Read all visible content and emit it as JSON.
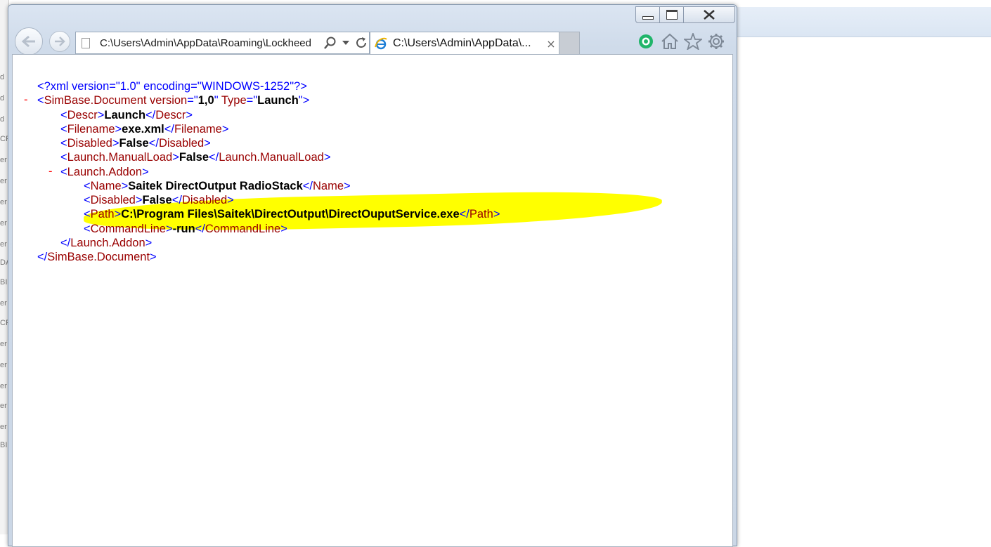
{
  "browser": {
    "address": "C:\\Users\\Admin\\AppData\\Roaming\\Lockheed",
    "tab_title": "C:\\Users\\Admin\\AppData\\...",
    "tab_close": "×"
  },
  "background_strip_letters": [
    "d",
    "d",
    "d",
    "CF",
    "er",
    "er",
    "er",
    "er",
    "er",
    "DA",
    "BI",
    "er",
    "CF",
    "er",
    "er",
    "er",
    "er",
    "er",
    "BI"
  ],
  "xml": {
    "declaration": "<?xml version=\"1.0\" encoding=\"WINDOWS-1252\"?>",
    "collapse_marker": "-",
    "root_open_tag": "SimBase.Document",
    "root_attr1_name": "version",
    "root_attr1_value": "1,0",
    "root_attr2_name": "Type",
    "root_attr2_value": "Launch",
    "descr_tag": "Descr",
    "descr_value": "Launch",
    "filename_tag": "Filename",
    "filename_value": "exe.xml",
    "disabled_tag": "Disabled",
    "disabled_value": "False",
    "manualload_tag": "Launch.ManualLoad",
    "manualload_value": "False",
    "addon_tag": "Launch.Addon",
    "name_tag": "Name",
    "name_value": "Saitek DirectOutput RadioStack",
    "addon_disabled_tag": "Disabled",
    "addon_disabled_value": "False",
    "path_tag": "Path",
    "path_value": "C:\\Program Files\\Saitek\\DirectOutput\\DirectOuputService.exe",
    "commandline_tag": "CommandLine",
    "commandline_value": "-run",
    "addon_close_tag": "Launch.Addon",
    "root_close_tag": "SimBase.Document"
  },
  "colors": {
    "markup": "#0000ff",
    "tag_name": "#990000",
    "highlight": "#ffff00",
    "collapse": "#ff0000"
  }
}
